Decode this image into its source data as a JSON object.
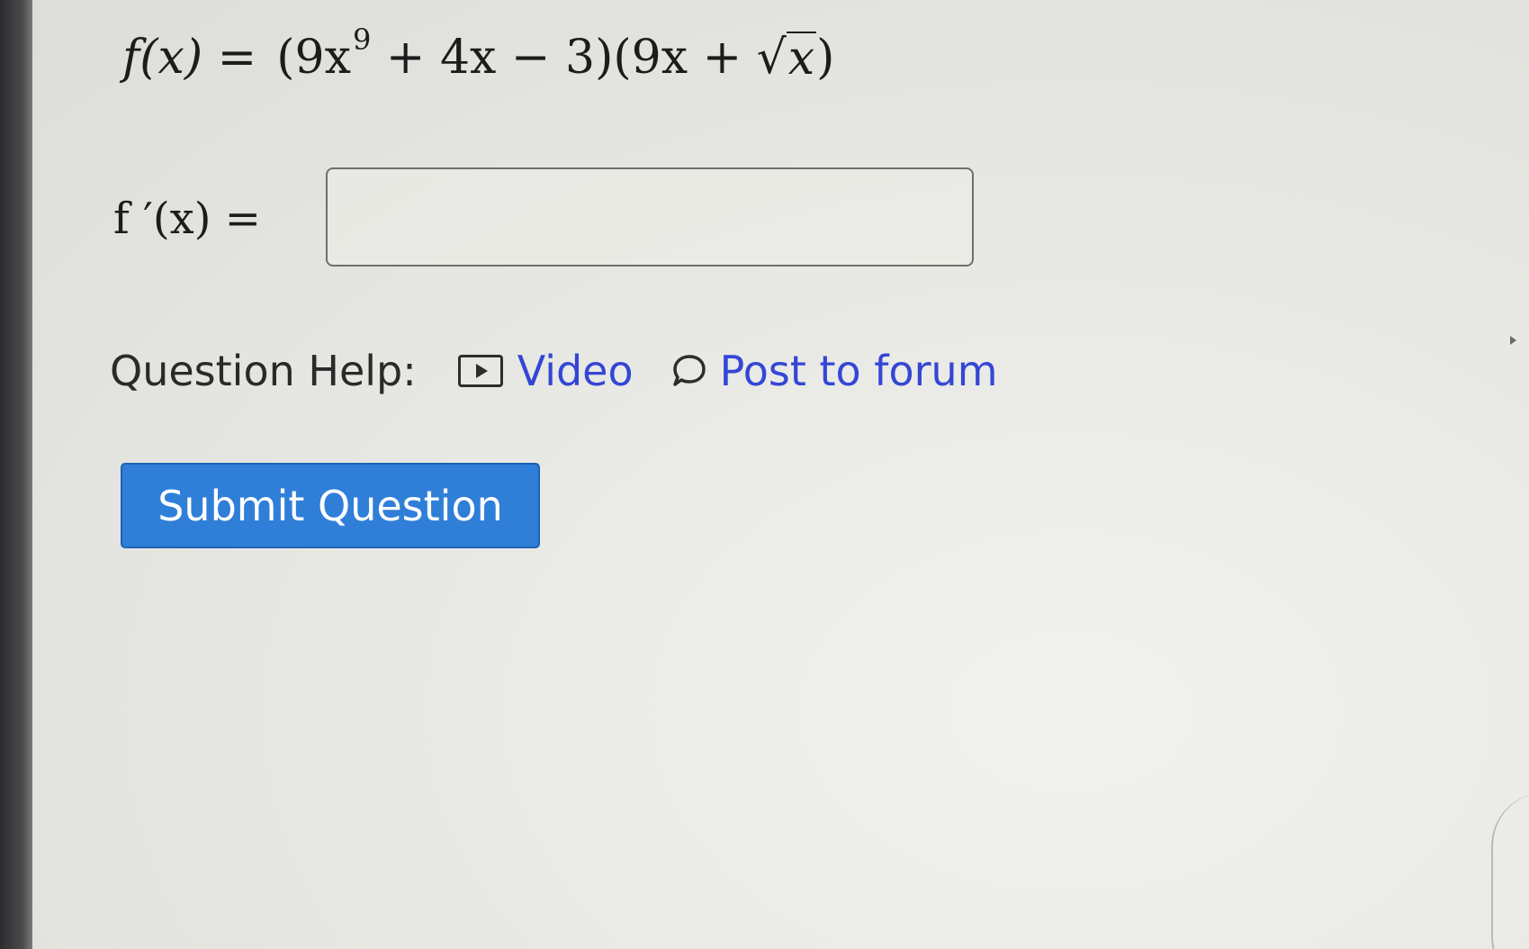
{
  "problem": {
    "function_name": "f(x) =",
    "expr_part1": "(9x",
    "exponent": "9",
    "expr_part2": " + 4x − 3)(9x + ",
    "radicand": "x",
    "expr_close": ")"
  },
  "answer": {
    "label": "f ′(x) =",
    "value": ""
  },
  "help": {
    "label": "Question Help:",
    "video_label": "Video",
    "forum_label": "Post to forum"
  },
  "submit": {
    "label": "Submit Question"
  },
  "colors": {
    "link": "#3446d6",
    "submit_bg": "#2f7fd9",
    "submit_text": "#ffffff"
  },
  "icons": {
    "video": "video-play-icon",
    "forum": "speech-bubble-icon"
  }
}
